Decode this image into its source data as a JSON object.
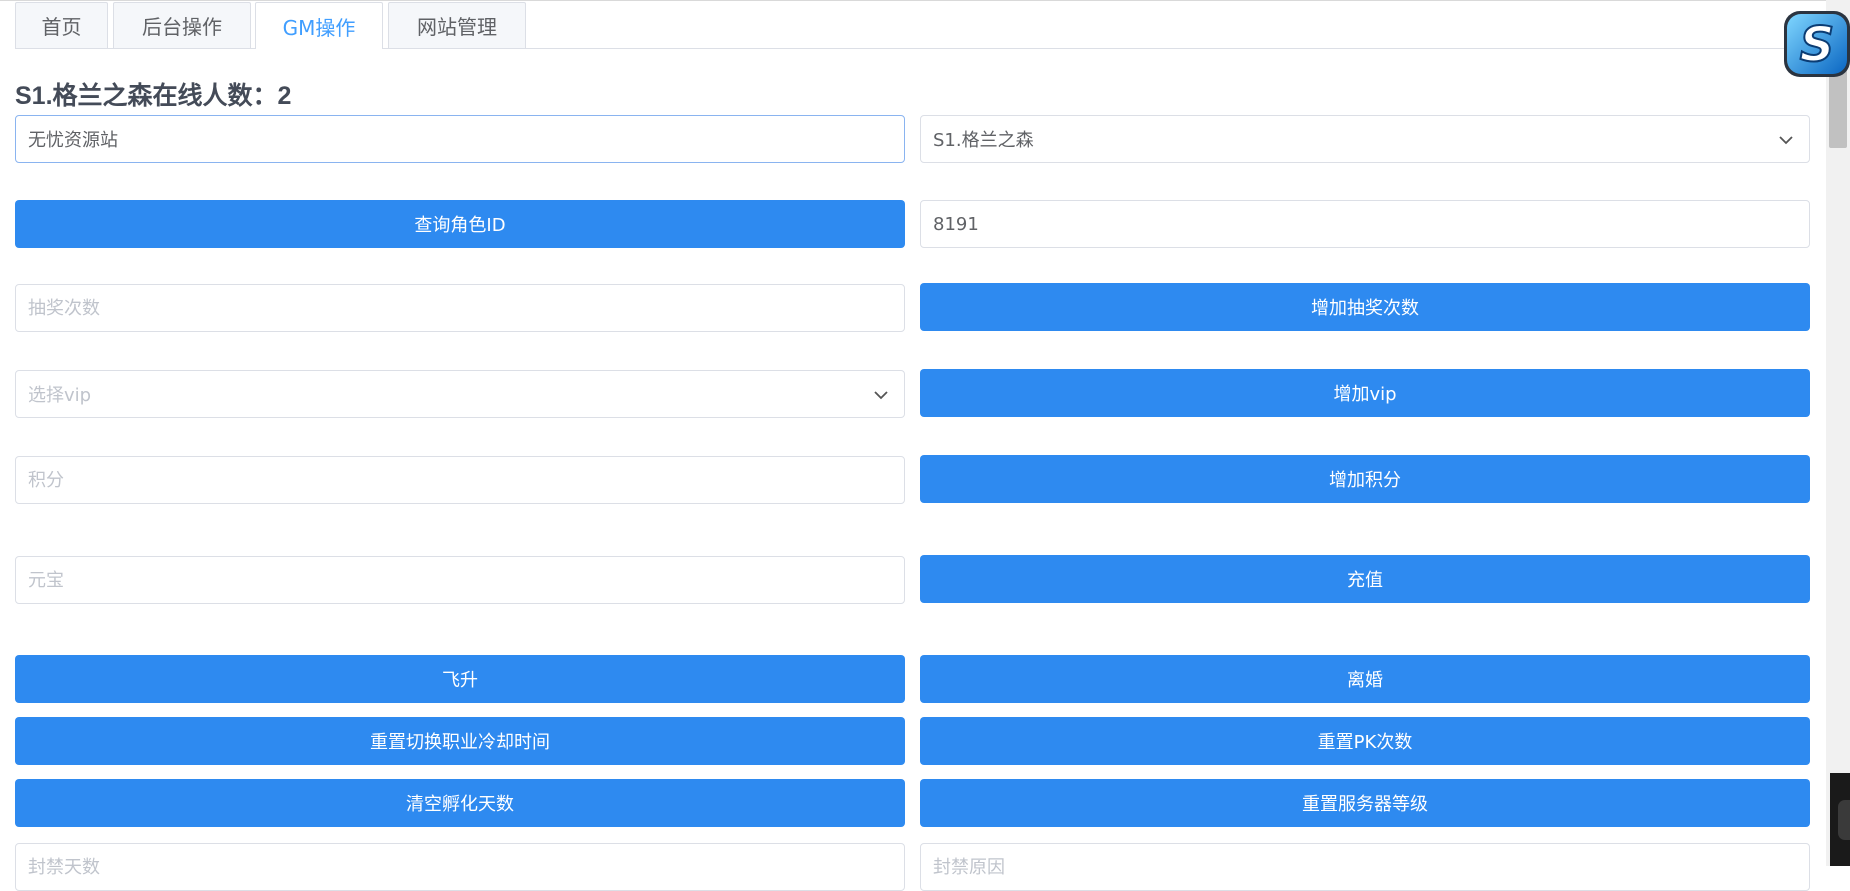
{
  "tabs": [
    {
      "label": "首页"
    },
    {
      "label": "后台操作"
    },
    {
      "label": "GM操作"
    },
    {
      "label": "网站管理"
    }
  ],
  "active_tab": "GM操作",
  "online_title": "S1.格兰之森在线人数：2",
  "account_input": {
    "value": "无忧资源站"
  },
  "server_select": {
    "value": "S1.格兰之森"
  },
  "query_role_button": {
    "label": "查询角色ID"
  },
  "role_id_input": {
    "value": "8191"
  },
  "lottery_input": {
    "placeholder": "抽奖次数"
  },
  "add_lottery_button": {
    "label": "增加抽奖次数"
  },
  "vip_select": {
    "placeholder": "选择vip"
  },
  "add_vip_button": {
    "label": "增加vip"
  },
  "points_input": {
    "placeholder": "积分"
  },
  "add_points_button": {
    "label": "增加积分"
  },
  "yuanbao_input": {
    "placeholder": "元宝"
  },
  "recharge_button": {
    "label": "充值"
  },
  "ascend_button": {
    "label": "飞升"
  },
  "divorce_button": {
    "label": "离婚"
  },
  "reset_job_cd_button": {
    "label": "重置切换职业冷却时间"
  },
  "reset_pk_button": {
    "label": "重置PK次数"
  },
  "clear_hatch_button": {
    "label": "清空孵化天数"
  },
  "reset_server_level_button": {
    "label": "重置服务器等级"
  },
  "ban_days_input": {
    "placeholder": "封禁天数"
  },
  "ban_reason_input": {
    "placeholder": "封禁原因"
  },
  "colors": {
    "primary": "#2e8af0",
    "active_tab_text": "#409eff"
  },
  "logo_letter": "S"
}
